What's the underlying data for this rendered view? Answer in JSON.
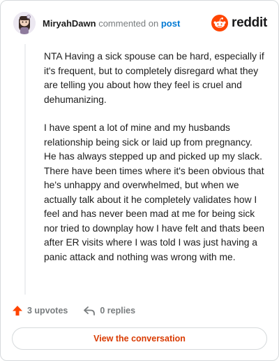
{
  "header": {
    "username": "MiryahDawn",
    "commented_on": "commented on",
    "post_link": "post",
    "brand": "reddit"
  },
  "comment": {
    "paragraphs": [
      "NTA Having a sick spouse can be hard, especially if it's frequent, but to completely disregard what they are telling you about how they feel is cruel and dehumanizing.",
      "I have spent a lot of mine and my husbands relationship being sick or laid up from pregnancy. He has always stepped up and picked up my slack. There have been times where it's been obvious that he's unhappy and overwhelmed, but when we actually talk about it he completely validates how I feel and has never been mad at me for being sick nor tried to downplay how I have felt and thats been after ER visits where I was told I was just having a panic attack and nothing was wrong with me."
    ]
  },
  "actions": {
    "upvotes": "3 upvotes",
    "replies": "0 replies"
  },
  "cta": {
    "label": "View the conversation"
  },
  "colors": {
    "upvote": "#ff4500",
    "link": "#0079d3",
    "cta_text": "#d93a00",
    "border": "#d6dadc"
  },
  "icons": {
    "avatar": "avatar",
    "brand": "reddit-snoo-icon",
    "upvote": "upvote-arrow-icon",
    "reply": "reply-arrow-icon"
  }
}
